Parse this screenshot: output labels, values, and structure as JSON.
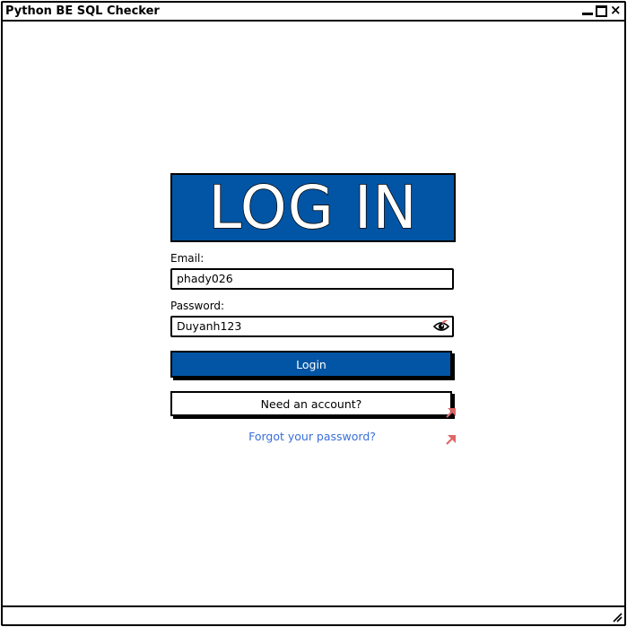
{
  "window": {
    "title": "Python BE SQL Checker"
  },
  "login": {
    "heading": "LOG IN",
    "email_label": "Email:",
    "email_value": "phady026",
    "password_label": "Password:",
    "password_value": "Duyanh123",
    "login_button": "Login",
    "signup_button": "Need an account?",
    "forgot_link": "Forgot your password?"
  },
  "icons": {
    "minimize": "minimize-icon",
    "maximize": "maximize-icon",
    "close": "close-icon",
    "show_password": "eye-icon",
    "link_arrow": "link-arrow-icon",
    "resize": "resize-grip-icon"
  },
  "colors": {
    "primary": "#0255a4",
    "link": "#3a6fd8",
    "link_arrow": "#e06666"
  }
}
